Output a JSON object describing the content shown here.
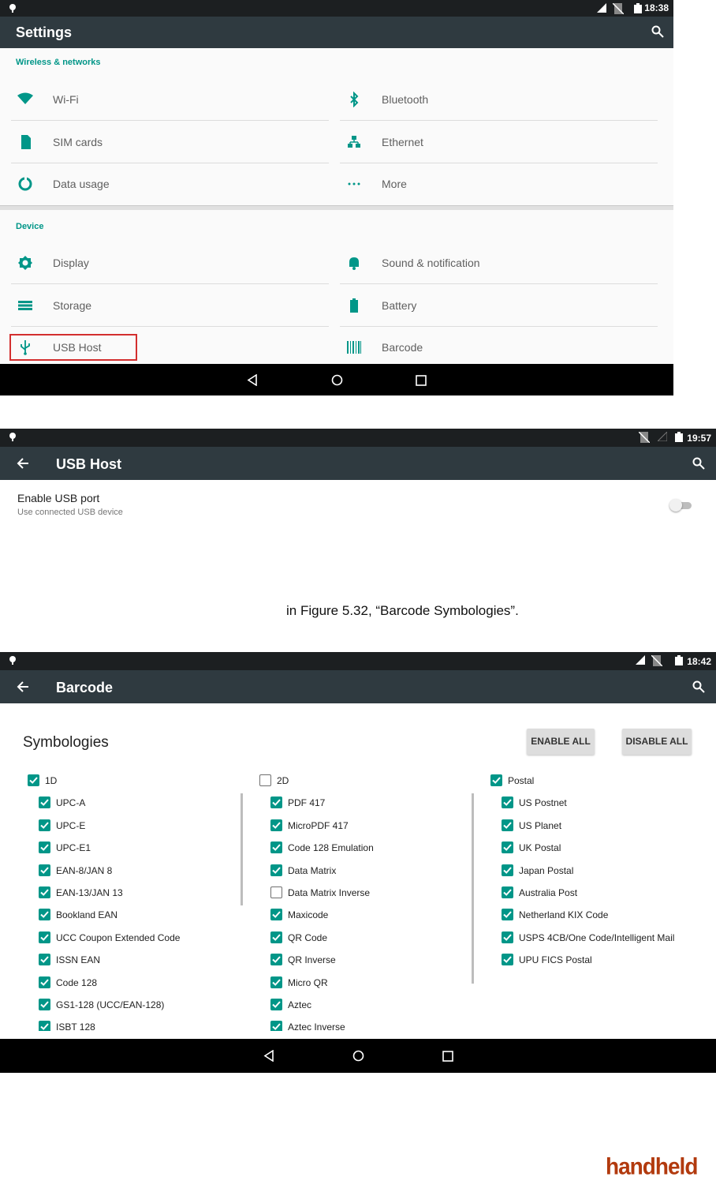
{
  "screen1": {
    "status": {
      "time": "18:38"
    },
    "appbar": {
      "title": "Settings"
    },
    "wireless": {
      "header": "Wireless & networks",
      "left": [
        {
          "label": "Wi-Fi",
          "icon": "wifi-icon"
        },
        {
          "label": "SIM cards",
          "icon": "sim-card-icon"
        },
        {
          "label": "Data usage",
          "icon": "data-usage-icon"
        }
      ],
      "right": [
        {
          "label": "Bluetooth",
          "icon": "bluetooth-icon"
        },
        {
          "label": "Ethernet",
          "icon": "ethernet-icon"
        },
        {
          "label": "More",
          "icon": "more-dots-icon"
        }
      ]
    },
    "device": {
      "header": "Device",
      "left": [
        {
          "label": "Display",
          "icon": "display-brightness-icon"
        },
        {
          "label": "Storage",
          "icon": "storage-icon"
        },
        {
          "label": "USB Host",
          "icon": "usb-icon"
        }
      ],
      "right": [
        {
          "label": "Sound & notification",
          "icon": "bell-icon"
        },
        {
          "label": "Battery",
          "icon": "battery-icon"
        },
        {
          "label": "Barcode",
          "icon": "barcode-icon"
        }
      ]
    }
  },
  "screen2": {
    "status": {
      "time": "19:57"
    },
    "appbar": {
      "title": "USB Host"
    },
    "pref": {
      "title": "Enable USB port",
      "summary": "Use connected USB device",
      "enabled": false
    }
  },
  "caption": "in Figure 5.32, “Barcode Symbologies”.",
  "screen3": {
    "status": {
      "time": "18:42"
    },
    "appbar": {
      "title": "Barcode"
    },
    "heading": "Symbologies",
    "enable_all": "ENABLE ALL",
    "disable_all": "DISABLE ALL",
    "columns": [
      {
        "group": {
          "label": "1D",
          "checked": true
        },
        "items": [
          {
            "label": "UPC-A",
            "checked": true
          },
          {
            "label": "UPC-E",
            "checked": true
          },
          {
            "label": "UPC-E1",
            "checked": true
          },
          {
            "label": "EAN-8/JAN 8",
            "checked": true
          },
          {
            "label": "EAN-13/JAN 13",
            "checked": true
          },
          {
            "label": "Bookland EAN",
            "checked": true
          },
          {
            "label": "UCC Coupon Extended Code",
            "checked": true
          },
          {
            "label": "ISSN EAN",
            "checked": true
          },
          {
            "label": "Code 128",
            "checked": true
          },
          {
            "label": "GS1-128 (UCC/EAN-128)",
            "checked": true
          },
          {
            "label": "ISBT 128",
            "checked": true
          }
        ]
      },
      {
        "group": {
          "label": "2D",
          "checked": false
        },
        "items": [
          {
            "label": "PDF 417",
            "checked": true
          },
          {
            "label": "MicroPDF 417",
            "checked": true
          },
          {
            "label": "Code 128 Emulation",
            "checked": true
          },
          {
            "label": "Data Matrix",
            "checked": true
          },
          {
            "label": "Data Matrix Inverse",
            "checked": false
          },
          {
            "label": "Maxicode",
            "checked": true
          },
          {
            "label": "QR Code",
            "checked": true
          },
          {
            "label": "QR Inverse",
            "checked": true
          },
          {
            "label": "Micro QR",
            "checked": true
          },
          {
            "label": "Aztec",
            "checked": true
          },
          {
            "label": "Aztec Inverse",
            "checked": true
          }
        ]
      },
      {
        "group": {
          "label": "Postal",
          "checked": true
        },
        "items": [
          {
            "label": "US Postnet",
            "checked": true
          },
          {
            "label": "US Planet",
            "checked": true
          },
          {
            "label": "UK Postal",
            "checked": true
          },
          {
            "label": "Japan Postal",
            "checked": true
          },
          {
            "label": "Australia Post",
            "checked": true
          },
          {
            "label": "Netherland KIX Code",
            "checked": true
          },
          {
            "label": "USPS 4CB/One Code/Intelligent Mail",
            "checked": true
          },
          {
            "label": "UPU FICS Postal",
            "checked": true
          }
        ]
      }
    ]
  },
  "logo": "handheld",
  "colors": {
    "accent": "#009688",
    "appbar": "#2f3a40",
    "statusbar": "#1c1f21",
    "highlight": "#d32f2f",
    "logo": "#b23a0e"
  }
}
